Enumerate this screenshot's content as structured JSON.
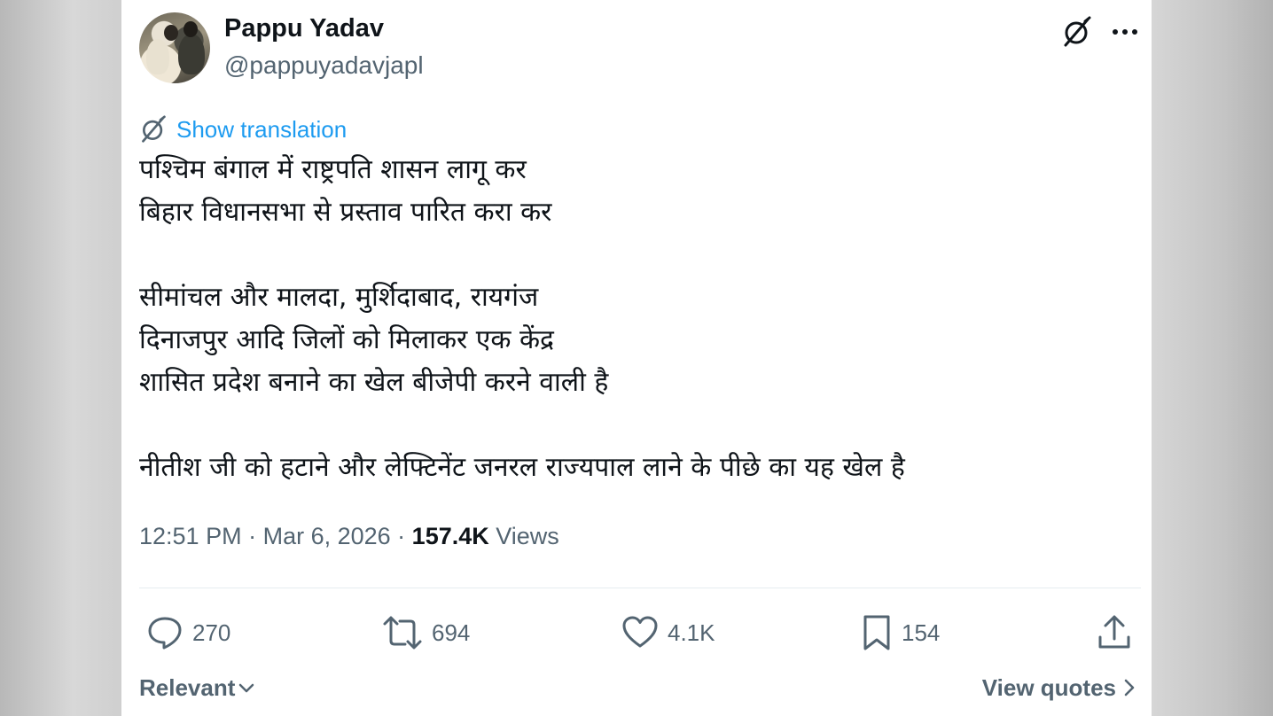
{
  "author": {
    "display_name": "Pappu Yadav",
    "handle": "@pappuyadavjapl"
  },
  "header_icons": {
    "grok": "grok-icon",
    "more": "more-options-icon"
  },
  "translation": {
    "icon": "translate-icon",
    "label": "Show translation"
  },
  "tweet": {
    "paragraphs": [
      [
        "पश्चिम बंगाल में राष्ट्रपति शासन लागू कर",
        "बिहार विधानसभा से प्रस्ताव पारित करा कर"
      ],
      [
        "सीमांचल और मालदा, मुर्शिदाबाद, रायगंज",
        "दिनाजपुर आदि जिलों को मिलाकर एक केंद्र",
        "शासित प्रदेश बनाने का खेल बीजेपी करने वाली है"
      ],
      [
        "नीतीश जी को हटाने और लेफ्टिनेंट जनरल राज्यपाल लाने के पीछे का यह खेल है"
      ]
    ]
  },
  "meta": {
    "time": "12:51 PM",
    "separator": " · ",
    "date": "Mar 6, 2026",
    "views_count": "157.4K",
    "views_label": " Views"
  },
  "actions": {
    "reply": {
      "icon": "reply-icon",
      "count": "270"
    },
    "repost": {
      "icon": "repost-icon",
      "count": "694"
    },
    "like": {
      "icon": "like-icon",
      "count": "4.1K"
    },
    "bookmark": {
      "icon": "bookmark-icon",
      "count": "154"
    },
    "share": {
      "icon": "share-icon"
    }
  },
  "footer": {
    "sort_label": "Relevant",
    "quotes_label": "View quotes"
  },
  "colors": {
    "accent": "#1d9bf0",
    "text_primary": "#0f1419",
    "text_secondary": "#536471",
    "divider": "#e6ecf0"
  }
}
